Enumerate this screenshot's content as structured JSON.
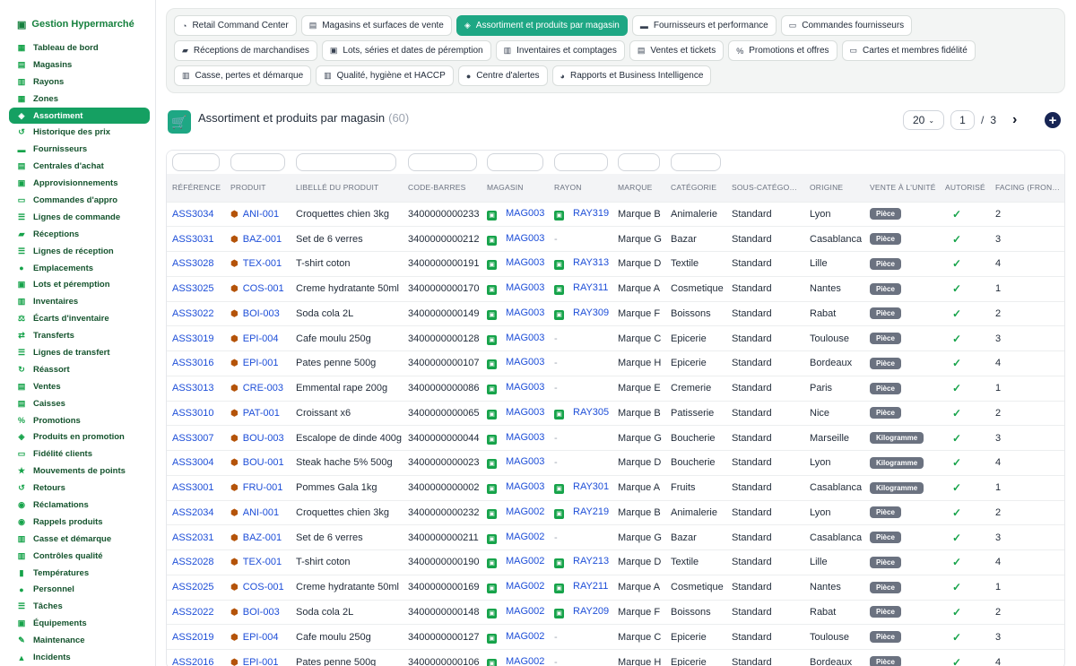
{
  "sidebar": {
    "brand": "Gestion Hypermarché",
    "items": [
      {
        "label": "Tableau de bord",
        "icon": "dashboard-icon",
        "glyph": "▦"
      },
      {
        "label": "Magasins",
        "icon": "store-icon",
        "glyph": "▤"
      },
      {
        "label": "Rayons",
        "icon": "shelf-icon",
        "glyph": "▥"
      },
      {
        "label": "Zones",
        "icon": "grid-icon",
        "glyph": "▦"
      },
      {
        "label": "Assortiment",
        "icon": "tags-icon",
        "glyph": "◈",
        "active": true
      },
      {
        "label": "Historique des prix",
        "icon": "history-icon",
        "glyph": "↺"
      },
      {
        "label": "Fournisseurs",
        "icon": "truck-icon",
        "glyph": "▬"
      },
      {
        "label": "Centrales d'achat",
        "icon": "building-icon",
        "glyph": "▤"
      },
      {
        "label": "Approvisionnements",
        "icon": "boxes-icon",
        "glyph": "▣"
      },
      {
        "label": "Commandes d'appro",
        "icon": "cart-icon",
        "glyph": "▭"
      },
      {
        "label": "Lignes de commande",
        "icon": "list-icon",
        "glyph": "☰"
      },
      {
        "label": "Réceptions",
        "icon": "dolly-icon",
        "glyph": "▰"
      },
      {
        "label": "Lignes de réception",
        "icon": "list-icon",
        "glyph": "☰"
      },
      {
        "label": "Emplacements",
        "icon": "location-icon",
        "glyph": "●"
      },
      {
        "label": "Lots et péremption",
        "icon": "cubes-icon",
        "glyph": "▣"
      },
      {
        "label": "Inventaires",
        "icon": "clipboard-icon",
        "glyph": "▥"
      },
      {
        "label": "Écarts d'inventaire",
        "icon": "balance-icon",
        "glyph": "⚖"
      },
      {
        "label": "Transferts",
        "icon": "exchange-icon",
        "glyph": "⇄"
      },
      {
        "label": "Lignes de transfert",
        "icon": "list-icon",
        "glyph": "☰"
      },
      {
        "label": "Réassort",
        "icon": "refresh-icon",
        "glyph": "↻"
      },
      {
        "label": "Ventes",
        "icon": "receipt-icon",
        "glyph": "▤"
      },
      {
        "label": "Caisses",
        "icon": "cash-register-icon",
        "glyph": "▤"
      },
      {
        "label": "Promotions",
        "icon": "percent-icon",
        "glyph": "%"
      },
      {
        "label": "Produits en promotion",
        "icon": "tag-icon",
        "glyph": "◈"
      },
      {
        "label": "Fidélité clients",
        "icon": "id-card-icon",
        "glyph": "▭"
      },
      {
        "label": "Mouvements de points",
        "icon": "star-icon",
        "glyph": "★"
      },
      {
        "label": "Retours",
        "icon": "undo-icon",
        "glyph": "↺"
      },
      {
        "label": "Réclamations",
        "icon": "comment-icon",
        "glyph": "◉"
      },
      {
        "label": "Rappels produits",
        "icon": "alert-circle-icon",
        "glyph": "◉"
      },
      {
        "label": "Casse et démarque",
        "icon": "trash-icon",
        "glyph": "▥"
      },
      {
        "label": "Contrôles qualité",
        "icon": "clipboard-check-icon",
        "glyph": "▥"
      },
      {
        "label": "Températures",
        "icon": "thermometer-icon",
        "glyph": "▮"
      },
      {
        "label": "Personnel",
        "icon": "user-icon",
        "glyph": "●"
      },
      {
        "label": "Tâches",
        "icon": "tasks-icon",
        "glyph": "☰"
      },
      {
        "label": "Équipements",
        "icon": "tools-icon",
        "glyph": "▣"
      },
      {
        "label": "Maintenance",
        "icon": "wrench-icon",
        "glyph": "✎"
      },
      {
        "label": "Incidents",
        "icon": "warning-icon",
        "glyph": "▲"
      }
    ]
  },
  "tabs": {
    "rows": [
      [
        {
          "label": "Retail Command Center",
          "icon": "gauge-icon",
          "glyph": "◔"
        },
        {
          "label": "Magasins et surfaces de vente",
          "icon": "store-icon",
          "glyph": "▤"
        },
        {
          "label": "Assortiment et produits par magasin",
          "icon": "tags-icon",
          "glyph": "◈",
          "active": true
        },
        {
          "label": "Fournisseurs et performance",
          "icon": "truck-icon",
          "glyph": "▬"
        },
        {
          "label": "Commandes fournisseurs",
          "icon": "cart-icon",
          "glyph": "▭"
        }
      ],
      [
        {
          "label": "Réceptions de marchandises",
          "icon": "dolly-icon",
          "glyph": "▰"
        },
        {
          "label": "Lots, séries et dates de péremption",
          "icon": "cubes-icon",
          "glyph": "▣"
        },
        {
          "label": "Inventaires et comptages",
          "icon": "clipboard-icon",
          "glyph": "▥"
        },
        {
          "label": "Ventes et tickets",
          "icon": "receipt-icon",
          "glyph": "▤"
        },
        {
          "label": "Promotions et offres",
          "icon": "percent-icon",
          "glyph": "%"
        },
        {
          "label": "Cartes et membres fidélité",
          "icon": "id-card-icon",
          "glyph": "▭"
        }
      ],
      [
        {
          "label": "Casse, pertes et démarque",
          "icon": "trash-icon",
          "glyph": "▥"
        },
        {
          "label": "Qualité, hygiène et HACCP",
          "icon": "clipboard-check-icon",
          "glyph": "▥"
        },
        {
          "label": "Centre d'alertes",
          "icon": "bell-icon",
          "glyph": "●"
        },
        {
          "label": "Rapports et Business Intelligence",
          "icon": "chart-pie-icon",
          "glyph": "◕"
        }
      ]
    ]
  },
  "header": {
    "title": "Assortiment et produits par magasin",
    "count": "(60)",
    "per_page": "20",
    "page": "1",
    "page_sep": "/",
    "total_pages": "3",
    "next": "›",
    "add": "+"
  },
  "table": {
    "columns": [
      "RÉFÉRENCE",
      "PRODUIT",
      "LIBELLÉ DU PRODUIT",
      "CODE-BARRES",
      "MAGASIN",
      "RAYON",
      "MARQUE",
      "CATÉGORIE",
      "SOUS-CATÉGO…",
      "ORIGINE",
      "VENTE À L'UNITÉ",
      "AUTORISÉ",
      "FACING (FRON…"
    ],
    "rows": [
      [
        "ASS3034",
        "ANI-001",
        "Croquettes chien 3kg",
        "3400000000233",
        "MAG003",
        "RAY319",
        "Marque B",
        "Animalerie",
        "Standard",
        "Lyon",
        "Pièce",
        "✓",
        "2"
      ],
      [
        "ASS3031",
        "BAZ-001",
        "Set de 6 verres",
        "3400000000212",
        "MAG003",
        "-",
        "Marque G",
        "Bazar",
        "Standard",
        "Casablanca",
        "Pièce",
        "✓",
        "3"
      ],
      [
        "ASS3028",
        "TEX-001",
        "T-shirt coton",
        "3400000000191",
        "MAG003",
        "RAY313",
        "Marque D",
        "Textile",
        "Standard",
        "Lille",
        "Pièce",
        "✓",
        "4"
      ],
      [
        "ASS3025",
        "COS-001",
        "Creme hydratante 50ml",
        "3400000000170",
        "MAG003",
        "RAY311",
        "Marque A",
        "Cosmetique",
        "Standard",
        "Nantes",
        "Pièce",
        "✓",
        "1"
      ],
      [
        "ASS3022",
        "BOI-003",
        "Soda cola 2L",
        "3400000000149",
        "MAG003",
        "RAY309",
        "Marque F",
        "Boissons",
        "Standard",
        "Rabat",
        "Pièce",
        "✓",
        "2"
      ],
      [
        "ASS3019",
        "EPI-004",
        "Cafe moulu 250g",
        "3400000000128",
        "MAG003",
        "-",
        "Marque C",
        "Epicerie",
        "Standard",
        "Toulouse",
        "Pièce",
        "✓",
        "3"
      ],
      [
        "ASS3016",
        "EPI-001",
        "Pates penne 500g",
        "3400000000107",
        "MAG003",
        "-",
        "Marque H",
        "Epicerie",
        "Standard",
        "Bordeaux",
        "Pièce",
        "✓",
        "4"
      ],
      [
        "ASS3013",
        "CRE-003",
        "Emmental rape 200g",
        "3400000000086",
        "MAG003",
        "-",
        "Marque E",
        "Cremerie",
        "Standard",
        "Paris",
        "Pièce",
        "✓",
        "1"
      ],
      [
        "ASS3010",
        "PAT-001",
        "Croissant x6",
        "3400000000065",
        "MAG003",
        "RAY305",
        "Marque B",
        "Patisserie",
        "Standard",
        "Nice",
        "Pièce",
        "✓",
        "2"
      ],
      [
        "ASS3007",
        "BOU-003",
        "Escalope de dinde 400g",
        "3400000000044",
        "MAG003",
        "-",
        "Marque G",
        "Boucherie",
        "Standard",
        "Marseille",
        "Kilogramme",
        "✓",
        "3"
      ],
      [
        "ASS3004",
        "BOU-001",
        "Steak hache 5% 500g",
        "3400000000023",
        "MAG003",
        "-",
        "Marque D",
        "Boucherie",
        "Standard",
        "Lyon",
        "Kilogramme",
        "✓",
        "4"
      ],
      [
        "ASS3001",
        "FRU-001",
        "Pommes Gala 1kg",
        "3400000000002",
        "MAG003",
        "RAY301",
        "Marque A",
        "Fruits",
        "Standard",
        "Casablanca",
        "Kilogramme",
        "✓",
        "1"
      ],
      [
        "ASS2034",
        "ANI-001",
        "Croquettes chien 3kg",
        "3400000000232",
        "MAG002",
        "RAY219",
        "Marque B",
        "Animalerie",
        "Standard",
        "Lyon",
        "Pièce",
        "✓",
        "2"
      ],
      [
        "ASS2031",
        "BAZ-001",
        "Set de 6 verres",
        "3400000000211",
        "MAG002",
        "-",
        "Marque G",
        "Bazar",
        "Standard",
        "Casablanca",
        "Pièce",
        "✓",
        "3"
      ],
      [
        "ASS2028",
        "TEX-001",
        "T-shirt coton",
        "3400000000190",
        "MAG002",
        "RAY213",
        "Marque D",
        "Textile",
        "Standard",
        "Lille",
        "Pièce",
        "✓",
        "4"
      ],
      [
        "ASS2025",
        "COS-001",
        "Creme hydratante 50ml",
        "3400000000169",
        "MAG002",
        "RAY211",
        "Marque A",
        "Cosmetique",
        "Standard",
        "Nantes",
        "Pièce",
        "✓",
        "1"
      ],
      [
        "ASS2022",
        "BOI-003",
        "Soda cola 2L",
        "3400000000148",
        "MAG002",
        "RAY209",
        "Marque F",
        "Boissons",
        "Standard",
        "Rabat",
        "Pièce",
        "✓",
        "2"
      ],
      [
        "ASS2019",
        "EPI-004",
        "Cafe moulu 250g",
        "3400000000127",
        "MAG002",
        "-",
        "Marque C",
        "Epicerie",
        "Standard",
        "Toulouse",
        "Pièce",
        "✓",
        "3"
      ],
      [
        "ASS2016",
        "EPI-001",
        "Pates penne 500g",
        "3400000000106",
        "MAG002",
        "-",
        "Marque H",
        "Epicerie",
        "Standard",
        "Bordeaux",
        "Pièce",
        "✓",
        "4"
      ]
    ]
  },
  "colors": {
    "accent": "#1ea784",
    "sidebar_active": "#15a062",
    "link": "#1d4ed8",
    "badge": "#6b7280",
    "check": "#16a34a",
    "add_button": "#172554"
  }
}
